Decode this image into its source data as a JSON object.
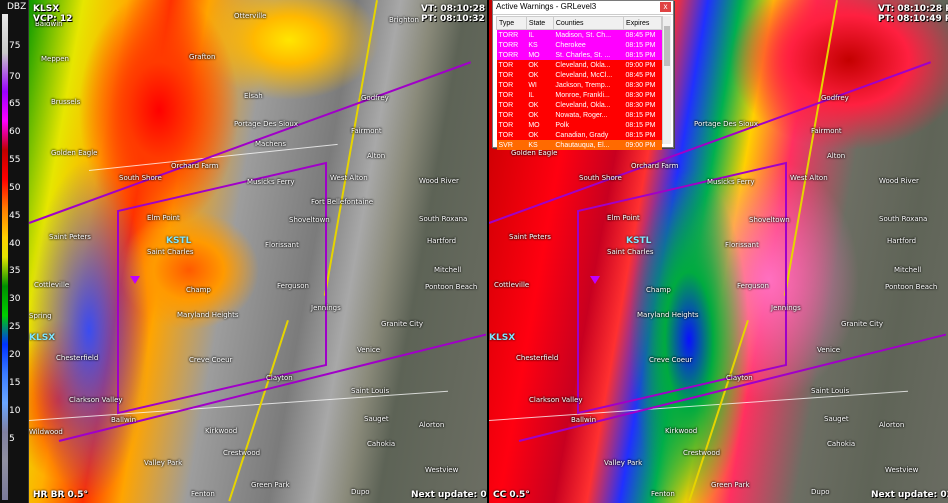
{
  "legend": {
    "unit": "DBZ",
    "labels": [
      "75",
      "70",
      "65",
      "60",
      "55",
      "50",
      "45",
      "40",
      "35",
      "30",
      "25",
      "20",
      "15",
      "10",
      "5"
    ]
  },
  "left_panel": {
    "site": "KLSX",
    "vcp": "VCP: 12",
    "vt": "VT: 08:10:28 PM",
    "pt": "PT: 08:10:32 PM",
    "product": "HR BR 0.5°",
    "next_update": "Next update: 02:43",
    "towns": [
      {
        "name": "Baldwin",
        "t": 20,
        "l": 6
      },
      {
        "name": "Otterville",
        "t": 12,
        "l": 205
      },
      {
        "name": "Brighton",
        "t": 16,
        "l": 360
      },
      {
        "name": "Meppen",
        "t": 55,
        "l": 12
      },
      {
        "name": "Grafton",
        "t": 53,
        "l": 160
      },
      {
        "name": "Brussels",
        "t": 98,
        "l": 22
      },
      {
        "name": "Elsah",
        "t": 92,
        "l": 215
      },
      {
        "name": "Godfrey",
        "t": 94,
        "l": 332
      },
      {
        "name": "Portage Des Sioux",
        "t": 120,
        "l": 205
      },
      {
        "name": "Fairmont",
        "t": 127,
        "l": 322
      },
      {
        "name": "Machens",
        "t": 140,
        "l": 226
      },
      {
        "name": "Golden Eagle",
        "t": 149,
        "l": 22
      },
      {
        "name": "Orchard Farm",
        "t": 162,
        "l": 142
      },
      {
        "name": "Alton",
        "t": 152,
        "l": 338
      },
      {
        "name": "South Shore",
        "t": 174,
        "l": 90
      },
      {
        "name": "Musicks Ferry",
        "t": 178,
        "l": 218
      },
      {
        "name": "West Alton",
        "t": 174,
        "l": 301
      },
      {
        "name": "Wood River",
        "t": 177,
        "l": 390
      },
      {
        "name": "Fort Bellefontaine",
        "t": 198,
        "l": 282
      },
      {
        "name": "Elm Point",
        "t": 214,
        "l": 118
      },
      {
        "name": "Shoveltown",
        "t": 216,
        "l": 260
      },
      {
        "name": "South Roxana",
        "t": 215,
        "l": 390
      },
      {
        "name": "Saint Peters",
        "t": 233,
        "l": 20
      },
      {
        "name": "Saint Charles",
        "t": 248,
        "l": 118
      },
      {
        "name": "Florissant",
        "t": 241,
        "l": 236
      },
      {
        "name": "Hartford",
        "t": 237,
        "l": 398
      },
      {
        "name": "Cottleville",
        "t": 281,
        "l": 5
      },
      {
        "name": "Champ",
        "t": 286,
        "l": 157
      },
      {
        "name": "Ferguson",
        "t": 282,
        "l": 248
      },
      {
        "name": "Mitchell",
        "t": 266,
        "l": 405
      },
      {
        "name": "Pontoon Beach",
        "t": 283,
        "l": 396
      },
      {
        "name": "Maryland Heights",
        "t": 311,
        "l": 148
      },
      {
        "name": "Jennings",
        "t": 304,
        "l": 282
      },
      {
        "name": "Spring",
        "t": 312,
        "l": 0
      },
      {
        "name": "Granite City",
        "t": 320,
        "l": 352
      },
      {
        "name": "Chesterfield",
        "t": 354,
        "l": 27
      },
      {
        "name": "Creve Coeur",
        "t": 356,
        "l": 160
      },
      {
        "name": "Venice",
        "t": 346,
        "l": 328
      },
      {
        "name": "Clayton",
        "t": 374,
        "l": 237
      },
      {
        "name": "Saint Louis",
        "t": 387,
        "l": 322
      },
      {
        "name": "Clarkson Valley",
        "t": 396,
        "l": 40
      },
      {
        "name": "Ballwin",
        "t": 416,
        "l": 82
      },
      {
        "name": "Sauget",
        "t": 415,
        "l": 335
      },
      {
        "name": "Alorton",
        "t": 421,
        "l": 390
      },
      {
        "name": "Wildwood",
        "t": 428,
        "l": 0
      },
      {
        "name": "Kirkwood",
        "t": 427,
        "l": 176
      },
      {
        "name": "Cahokia",
        "t": 440,
        "l": 338
      },
      {
        "name": "Crestwood",
        "t": 449,
        "l": 194
      },
      {
        "name": "Valley Park",
        "t": 459,
        "l": 115
      },
      {
        "name": "Westview",
        "t": 466,
        "l": 396
      },
      {
        "name": "Fenton",
        "t": 490,
        "l": 162
      },
      {
        "name": "Green Park",
        "t": 481,
        "l": 222
      },
      {
        "name": "Dupo",
        "t": 488,
        "l": 322
      }
    ]
  },
  "right_panel": {
    "vt": "VT: 08:10:28 PM",
    "pt": "PT: 08:10:49 PM",
    "product": "CC 0.5°",
    "next_update": "Next update: 02:17",
    "site": "KLSX",
    "towns": [
      {
        "name": "Golden Eagle",
        "t": 149,
        "l": 22
      },
      {
        "name": "Alton",
        "t": 152,
        "l": 338
      },
      {
        "name": "Portage Des Sioux",
        "t": 120,
        "l": 205
      },
      {
        "name": "Fairmont",
        "t": 127,
        "l": 322
      },
      {
        "name": "Godfrey",
        "t": 94,
        "l": 332
      },
      {
        "name": "Orchard Farm",
        "t": 162,
        "l": 142
      },
      {
        "name": "South Shore",
        "t": 174,
        "l": 90
      },
      {
        "name": "Musicks Ferry",
        "t": 178,
        "l": 218
      },
      {
        "name": "West Alton",
        "t": 174,
        "l": 301
      },
      {
        "name": "Wood River",
        "t": 177,
        "l": 390
      },
      {
        "name": "Elm Point",
        "t": 214,
        "l": 118
      },
      {
        "name": "Shoveltown",
        "t": 216,
        "l": 260
      },
      {
        "name": "South Roxana",
        "t": 215,
        "l": 390
      },
      {
        "name": "Saint Peters",
        "t": 233,
        "l": 20
      },
      {
        "name": "Saint Charles",
        "t": 248,
        "l": 118
      },
      {
        "name": "Florissant",
        "t": 241,
        "l": 236
      },
      {
        "name": "Hartford",
        "t": 237,
        "l": 398
      },
      {
        "name": "Cottleville",
        "t": 281,
        "l": 5
      },
      {
        "name": "Champ",
        "t": 286,
        "l": 157
      },
      {
        "name": "Ferguson",
        "t": 282,
        "l": 248
      },
      {
        "name": "Mitchell",
        "t": 266,
        "l": 405
      },
      {
        "name": "Pontoon Beach",
        "t": 283,
        "l": 396
      },
      {
        "name": "Maryland Heights",
        "t": 311,
        "l": 148
      },
      {
        "name": "Jennings",
        "t": 304,
        "l": 282
      },
      {
        "name": "Granite City",
        "t": 320,
        "l": 352
      },
      {
        "name": "Chesterfield",
        "t": 354,
        "l": 27
      },
      {
        "name": "Creve Coeur",
        "t": 356,
        "l": 160
      },
      {
        "name": "Venice",
        "t": 346,
        "l": 328
      },
      {
        "name": "Clayton",
        "t": 374,
        "l": 237
      },
      {
        "name": "Saint Louis",
        "t": 387,
        "l": 322
      },
      {
        "name": "Clarkson Valley",
        "t": 396,
        "l": 40
      },
      {
        "name": "Ballwin",
        "t": 416,
        "l": 82
      },
      {
        "name": "Sauget",
        "t": 415,
        "l": 335
      },
      {
        "name": "Alorton",
        "t": 421,
        "l": 390
      },
      {
        "name": "Kirkwood",
        "t": 427,
        "l": 176
      },
      {
        "name": "Cahokia",
        "t": 440,
        "l": 338
      },
      {
        "name": "Crestwood",
        "t": 449,
        "l": 194
      },
      {
        "name": "Valley Park",
        "t": 459,
        "l": 115
      },
      {
        "name": "Westview",
        "t": 466,
        "l": 396
      },
      {
        "name": "Fenton",
        "t": 490,
        "l": 162
      },
      {
        "name": "Green Park",
        "t": 481,
        "l": 222
      },
      {
        "name": "Dupo",
        "t": 488,
        "l": 322
      }
    ]
  },
  "warnings": {
    "title": "Active Warnings - GRLevel3",
    "close_label": "x",
    "columns": [
      "Type",
      "State",
      "Counties",
      "Expires"
    ],
    "rows": [
      {
        "type": "TORR",
        "state": "IL",
        "counties": "Madison, St. Ch...",
        "expires": "08:45 PM",
        "kind": "torr"
      },
      {
        "type": "TORR",
        "state": "KS",
        "counties": "Cherokee",
        "expires": "08:15 PM",
        "kind": "torr"
      },
      {
        "type": "TORR",
        "state": "MO",
        "counties": "St. Charles, St. ...",
        "expires": "08:15 PM",
        "kind": "torr"
      },
      {
        "type": "TOR",
        "state": "OK",
        "counties": "Cleveland, Okla...",
        "expires": "09:00 PM",
        "kind": "tor"
      },
      {
        "type": "TOR",
        "state": "OK",
        "counties": "Cleveland, McCl...",
        "expires": "08:45 PM",
        "kind": "tor"
      },
      {
        "type": "TOR",
        "state": "WI",
        "counties": "Jackson, Tremp...",
        "expires": "08:30 PM",
        "kind": "tor"
      },
      {
        "type": "TOR",
        "state": "IL",
        "counties": "Monroe, Frankli...",
        "expires": "08:30 PM",
        "kind": "tor"
      },
      {
        "type": "TOR",
        "state": "OK",
        "counties": "Cleveland, Okla...",
        "expires": "08:30 PM",
        "kind": "tor"
      },
      {
        "type": "TOR",
        "state": "OK",
        "counties": "Nowata, Roger...",
        "expires": "08:15 PM",
        "kind": "tor"
      },
      {
        "type": "TOR",
        "state": "MO",
        "counties": "Polk",
        "expires": "08:15 PM",
        "kind": "tor"
      },
      {
        "type": "TOR",
        "state": "OK",
        "counties": "Canadian, Grady",
        "expires": "08:15 PM",
        "kind": "tor"
      },
      {
        "type": "SVR",
        "state": "KS",
        "counties": "Chautauqua, El...",
        "expires": "09:00 PM",
        "kind": "svr"
      }
    ]
  },
  "colors": {
    "polygon": "#a000c8",
    "highway": "#e6d400",
    "torr": "#ff00ff",
    "tor": "#ff0000"
  }
}
